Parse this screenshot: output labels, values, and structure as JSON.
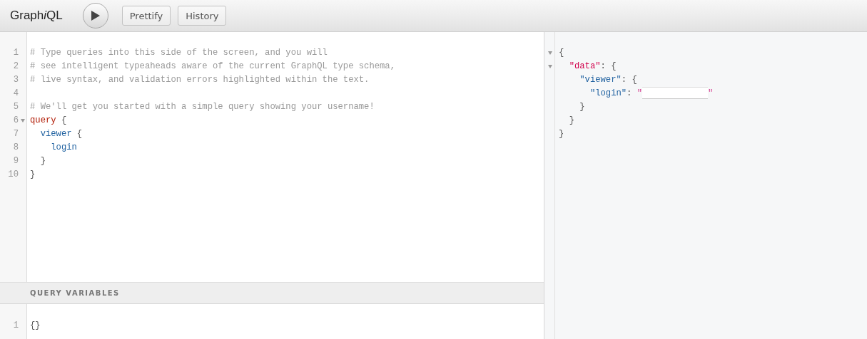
{
  "toolbar": {
    "logo": {
      "start": "Graph",
      "italic": "i",
      "end": "QL"
    },
    "buttons": [
      {
        "kind": "run"
      },
      {
        "kind": "text",
        "label": "Prettify"
      },
      {
        "kind": "text",
        "label": "History"
      }
    ]
  },
  "editor": {
    "lines": [
      {
        "number": "1",
        "foldable": false,
        "tokens": [
          {
            "kind": "comment",
            "text": "# Type queries into this side of the screen, and you will"
          }
        ]
      },
      {
        "number": "2",
        "foldable": false,
        "tokens": [
          {
            "kind": "comment",
            "text": "# see intelligent typeaheads aware of the current GraphQL type schema,"
          }
        ]
      },
      {
        "number": "3",
        "foldable": false,
        "tokens": [
          {
            "kind": "comment",
            "text": "# live syntax, and validation errors highlighted within the text."
          }
        ]
      },
      {
        "number": "4",
        "foldable": false
      },
      {
        "number": "5",
        "foldable": false,
        "tokens": [
          {
            "kind": "comment",
            "text": "# We'll get you started with a simple query showing your username!"
          }
        ]
      },
      {
        "number": "6",
        "foldable": true,
        "tokens": [
          {
            "kind": "keyword",
            "text": "query"
          },
          {
            "kind": "punct",
            "text": " {"
          }
        ]
      },
      {
        "number": "7",
        "foldable": false,
        "tokens": [
          {
            "kind": "field",
            "text": "  viewer"
          },
          {
            "kind": "punct",
            "text": " {"
          }
        ]
      },
      {
        "number": "8",
        "foldable": false,
        "tokens": [
          {
            "kind": "field",
            "text": "    login"
          }
        ]
      },
      {
        "number": "9",
        "foldable": false,
        "tokens": [
          {
            "kind": "punct",
            "text": "  }"
          }
        ]
      },
      {
        "number": "10",
        "foldable": false,
        "tokens": [
          {
            "kind": "punct",
            "text": "}"
          }
        ]
      }
    ]
  },
  "variables": {
    "title": "QUERY VARIABLES",
    "lines": [
      {
        "number": "1",
        "foldable": false,
        "tokens": [
          {
            "kind": "punct",
            "text": "{}"
          }
        ]
      }
    ]
  },
  "result": {
    "lines": [
      {
        "foldable": true,
        "tokens": [
          {
            "kind": "punct",
            "text": "{"
          }
        ]
      },
      {
        "foldable": true,
        "tokens": [
          {
            "kind": "key",
            "text": "  \"data\""
          },
          {
            "kind": "punct",
            "text": ": {"
          }
        ]
      },
      {
        "foldable": false,
        "tokens": [
          {
            "kind": "field",
            "text": "    \"viewer\""
          },
          {
            "kind": "punct",
            "text": ": {"
          }
        ]
      },
      {
        "foldable": false,
        "tokens": [
          {
            "kind": "field",
            "text": "      \"login\""
          },
          {
            "kind": "punct",
            "text": ": "
          },
          {
            "kind": "string",
            "text": "\""
          },
          {
            "kind": "redacted"
          },
          {
            "kind": "string",
            "text": "\""
          }
        ]
      },
      {
        "foldable": false,
        "tokens": [
          {
            "kind": "punct",
            "text": "    }"
          }
        ]
      },
      {
        "foldable": false,
        "tokens": [
          {
            "kind": "punct",
            "text": "  }"
          }
        ]
      },
      {
        "foldable": false,
        "tokens": [
          {
            "kind": "punct",
            "text": "}"
          }
        ]
      }
    ]
  }
}
